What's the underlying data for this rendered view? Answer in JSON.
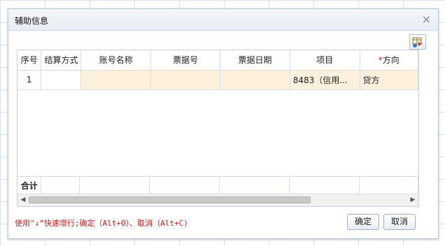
{
  "dialog": {
    "title": "辅助信息",
    "close_label": "×"
  },
  "toolbar": {
    "export_icon": "table-export-icon"
  },
  "table": {
    "columns": [
      {
        "label": "序号",
        "required": false
      },
      {
        "label": "结算方式",
        "required": false
      },
      {
        "label": "账号名称",
        "required": false
      },
      {
        "label": "票据号",
        "required": false
      },
      {
        "label": "票据日期",
        "required": false
      },
      {
        "label": "项目",
        "required": false
      },
      {
        "label": "方向",
        "required": true,
        "required_mark": "*"
      }
    ],
    "rows": [
      [
        "1",
        "",
        "",
        "",
        "",
        "8483（信用...",
        "贷方"
      ]
    ],
    "summary_label": "合计"
  },
  "footer": {
    "hint": "使用\"↓\"快速增行;确定（Alt+O）、取消（Alt+C)",
    "ok_label": "确定",
    "cancel_label": "取消"
  }
}
